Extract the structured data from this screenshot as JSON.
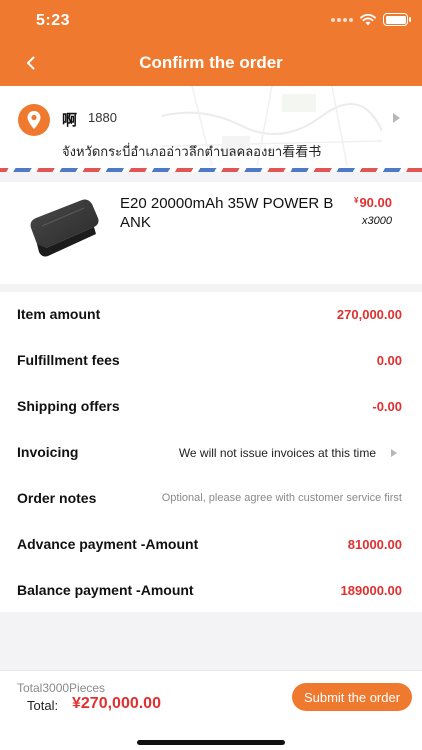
{
  "status_bar": {
    "time": "5:23"
  },
  "header": {
    "title": "Confirm the order"
  },
  "address": {
    "name": "啊",
    "phone": "1880",
    "line": "จังหวัดกระบี่อำเภออ่าวลึกตำบลคลองยา看看书"
  },
  "product": {
    "name": "E20 20000mAh 35W POWER BANK",
    "currency": "¥",
    "price": "90.00",
    "quantity": "x3000"
  },
  "summary": {
    "item_amount_label": "Item amount",
    "item_amount": "270,000.00",
    "fulfillment_label": "Fulfillment fees",
    "fulfillment": "0.00",
    "shipping_label": "Shipping offers",
    "shipping": "-0.00",
    "invoicing_label": "Invoicing",
    "invoicing_value": "We will not issue invoices at this time",
    "notes_label": "Order notes",
    "notes_placeholder": "Optional, please agree with customer service first",
    "notes_value": "",
    "advance_label": "Advance payment -Amount",
    "advance": "81000.00",
    "balance_label": "Balance payment -Amount",
    "balance": "189000.00"
  },
  "footer": {
    "count": "Total3000Pieces",
    "total_label": "Total:",
    "total_amount": "¥270,000.00",
    "submit_label": "Submit the order"
  },
  "colors": {
    "accent": "#ef7a2f",
    "price": "#e03030"
  }
}
